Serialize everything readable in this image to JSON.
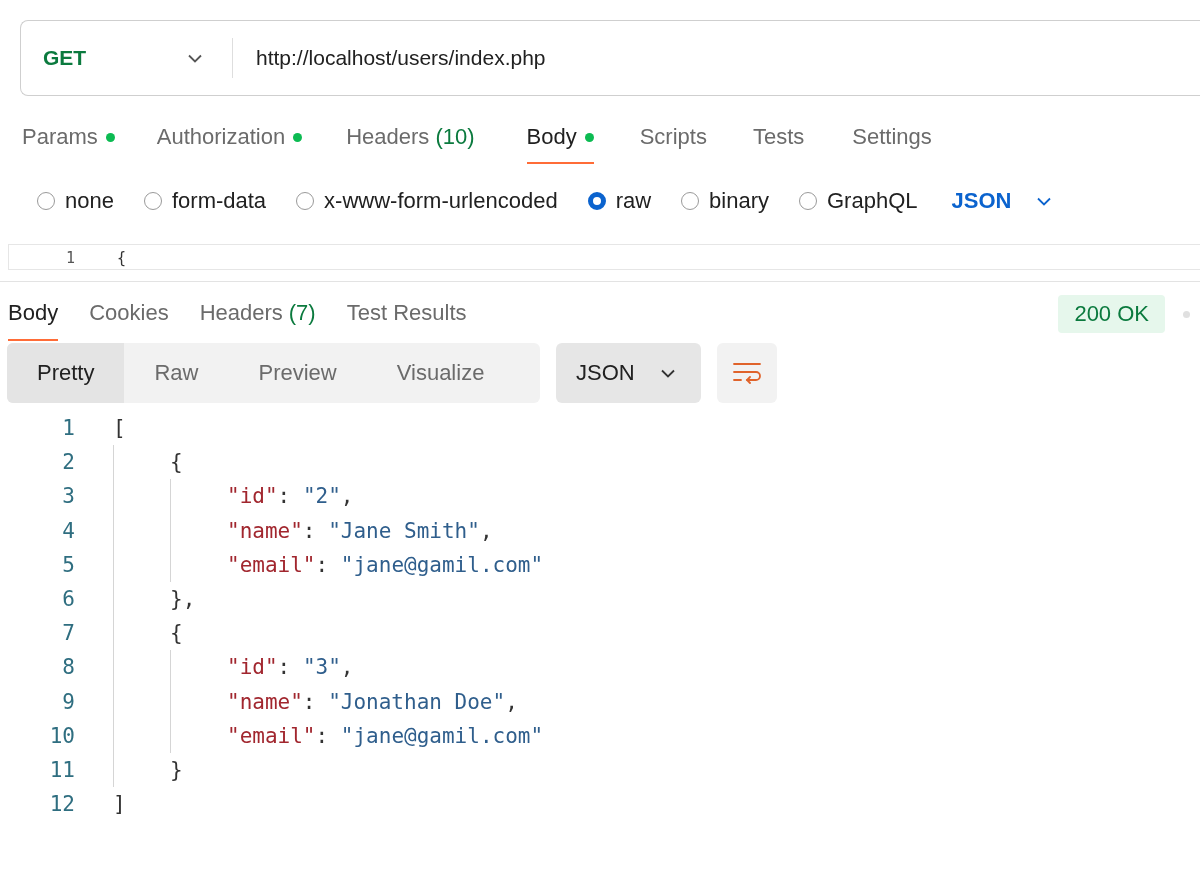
{
  "request": {
    "method": "GET",
    "url": "http://localhost/users/index.php"
  },
  "request_tabs": [
    {
      "label": "Params",
      "dot": true,
      "selected": false
    },
    {
      "label": "Authorization",
      "dot": true,
      "selected": false
    },
    {
      "label": "Headers",
      "count": "(10)",
      "dot": false,
      "selected": false
    },
    {
      "label": "Body",
      "dot": true,
      "selected": true
    },
    {
      "label": "Scripts",
      "dot": false,
      "selected": false
    },
    {
      "label": "Tests",
      "dot": false,
      "selected": false
    },
    {
      "label": "Settings",
      "dot": false,
      "selected": false
    }
  ],
  "body_types": [
    {
      "label": "none",
      "selected": false
    },
    {
      "label": "form-data",
      "selected": false
    },
    {
      "label": "x-www-form-urlencoded",
      "selected": false
    },
    {
      "label": "raw",
      "selected": true
    },
    {
      "label": "binary",
      "selected": false
    },
    {
      "label": "GraphQL",
      "selected": false
    }
  ],
  "body_format": "JSON",
  "request_editor": {
    "lines": [
      {
        "number": "1",
        "tokens": [
          {
            "kind": "punct",
            "text": "{"
          }
        ]
      }
    ]
  },
  "response_tabs": [
    {
      "label": "Body",
      "selected": true
    },
    {
      "label": "Cookies",
      "selected": false
    },
    {
      "label": "Headers",
      "count": "(7)",
      "selected": false
    },
    {
      "label": "Test Results",
      "selected": false
    }
  ],
  "status": "200 OK",
  "view_modes": [
    {
      "label": "Pretty",
      "selected": true
    },
    {
      "label": "Raw",
      "selected": false
    },
    {
      "label": "Preview",
      "selected": false
    },
    {
      "label": "Visualize",
      "selected": false
    }
  ],
  "response_format": "JSON",
  "response_body": {
    "lines": [
      {
        "number": "1",
        "tokens": [
          {
            "kind": "punct",
            "text": "["
          }
        ],
        "children": [
          {
            "number": "2",
            "tokens": [
              {
                "kind": "punct",
                "text": "{"
              }
            ],
            "children": [
              {
                "number": "3",
                "tokens": [
                  {
                    "kind": "key",
                    "text": "\"id\""
                  },
                  {
                    "kind": "punct",
                    "text": ": "
                  },
                  {
                    "kind": "string",
                    "text": "\"2\""
                  },
                  {
                    "kind": "punct",
                    "text": ","
                  }
                ]
              },
              {
                "number": "4",
                "tokens": [
                  {
                    "kind": "key",
                    "text": "\"name\""
                  },
                  {
                    "kind": "punct",
                    "text": ": "
                  },
                  {
                    "kind": "string",
                    "text": "\"Jane Smith\""
                  },
                  {
                    "kind": "punct",
                    "text": ","
                  }
                ]
              },
              {
                "number": "5",
                "tokens": [
                  {
                    "kind": "key",
                    "text": "\"email\""
                  },
                  {
                    "kind": "punct",
                    "text": ": "
                  },
                  {
                    "kind": "string",
                    "text": "\"jane@gamil.com\""
                  }
                ]
              }
            ]
          },
          {
            "number": "6",
            "tokens": [
              {
                "kind": "punct",
                "text": "},"
              }
            ]
          },
          {
            "number": "7",
            "tokens": [
              {
                "kind": "punct",
                "text": "{"
              }
            ],
            "children": [
              {
                "number": "8",
                "tokens": [
                  {
                    "kind": "key",
                    "text": "\"id\""
                  },
                  {
                    "kind": "punct",
                    "text": ": "
                  },
                  {
                    "kind": "string",
                    "text": "\"3\""
                  },
                  {
                    "kind": "punct",
                    "text": ","
                  }
                ]
              },
              {
                "number": "9",
                "tokens": [
                  {
                    "kind": "key",
                    "text": "\"name\""
                  },
                  {
                    "kind": "punct",
                    "text": ": "
                  },
                  {
                    "kind": "string",
                    "text": "\"Jonathan Doe\""
                  },
                  {
                    "kind": "punct",
                    "text": ","
                  }
                ]
              },
              {
                "number": "10",
                "tokens": [
                  {
                    "kind": "key",
                    "text": "\"email\""
                  },
                  {
                    "kind": "punct",
                    "text": ": "
                  },
                  {
                    "kind": "string",
                    "text": "\"jane@gamil.com\""
                  }
                ]
              }
            ]
          },
          {
            "number": "11",
            "tokens": [
              {
                "kind": "punct",
                "text": "}"
              }
            ]
          }
        ]
      },
      {
        "number": "12",
        "tokens": [
          {
            "kind": "punct",
            "text": "]"
          }
        ]
      }
    ]
  }
}
